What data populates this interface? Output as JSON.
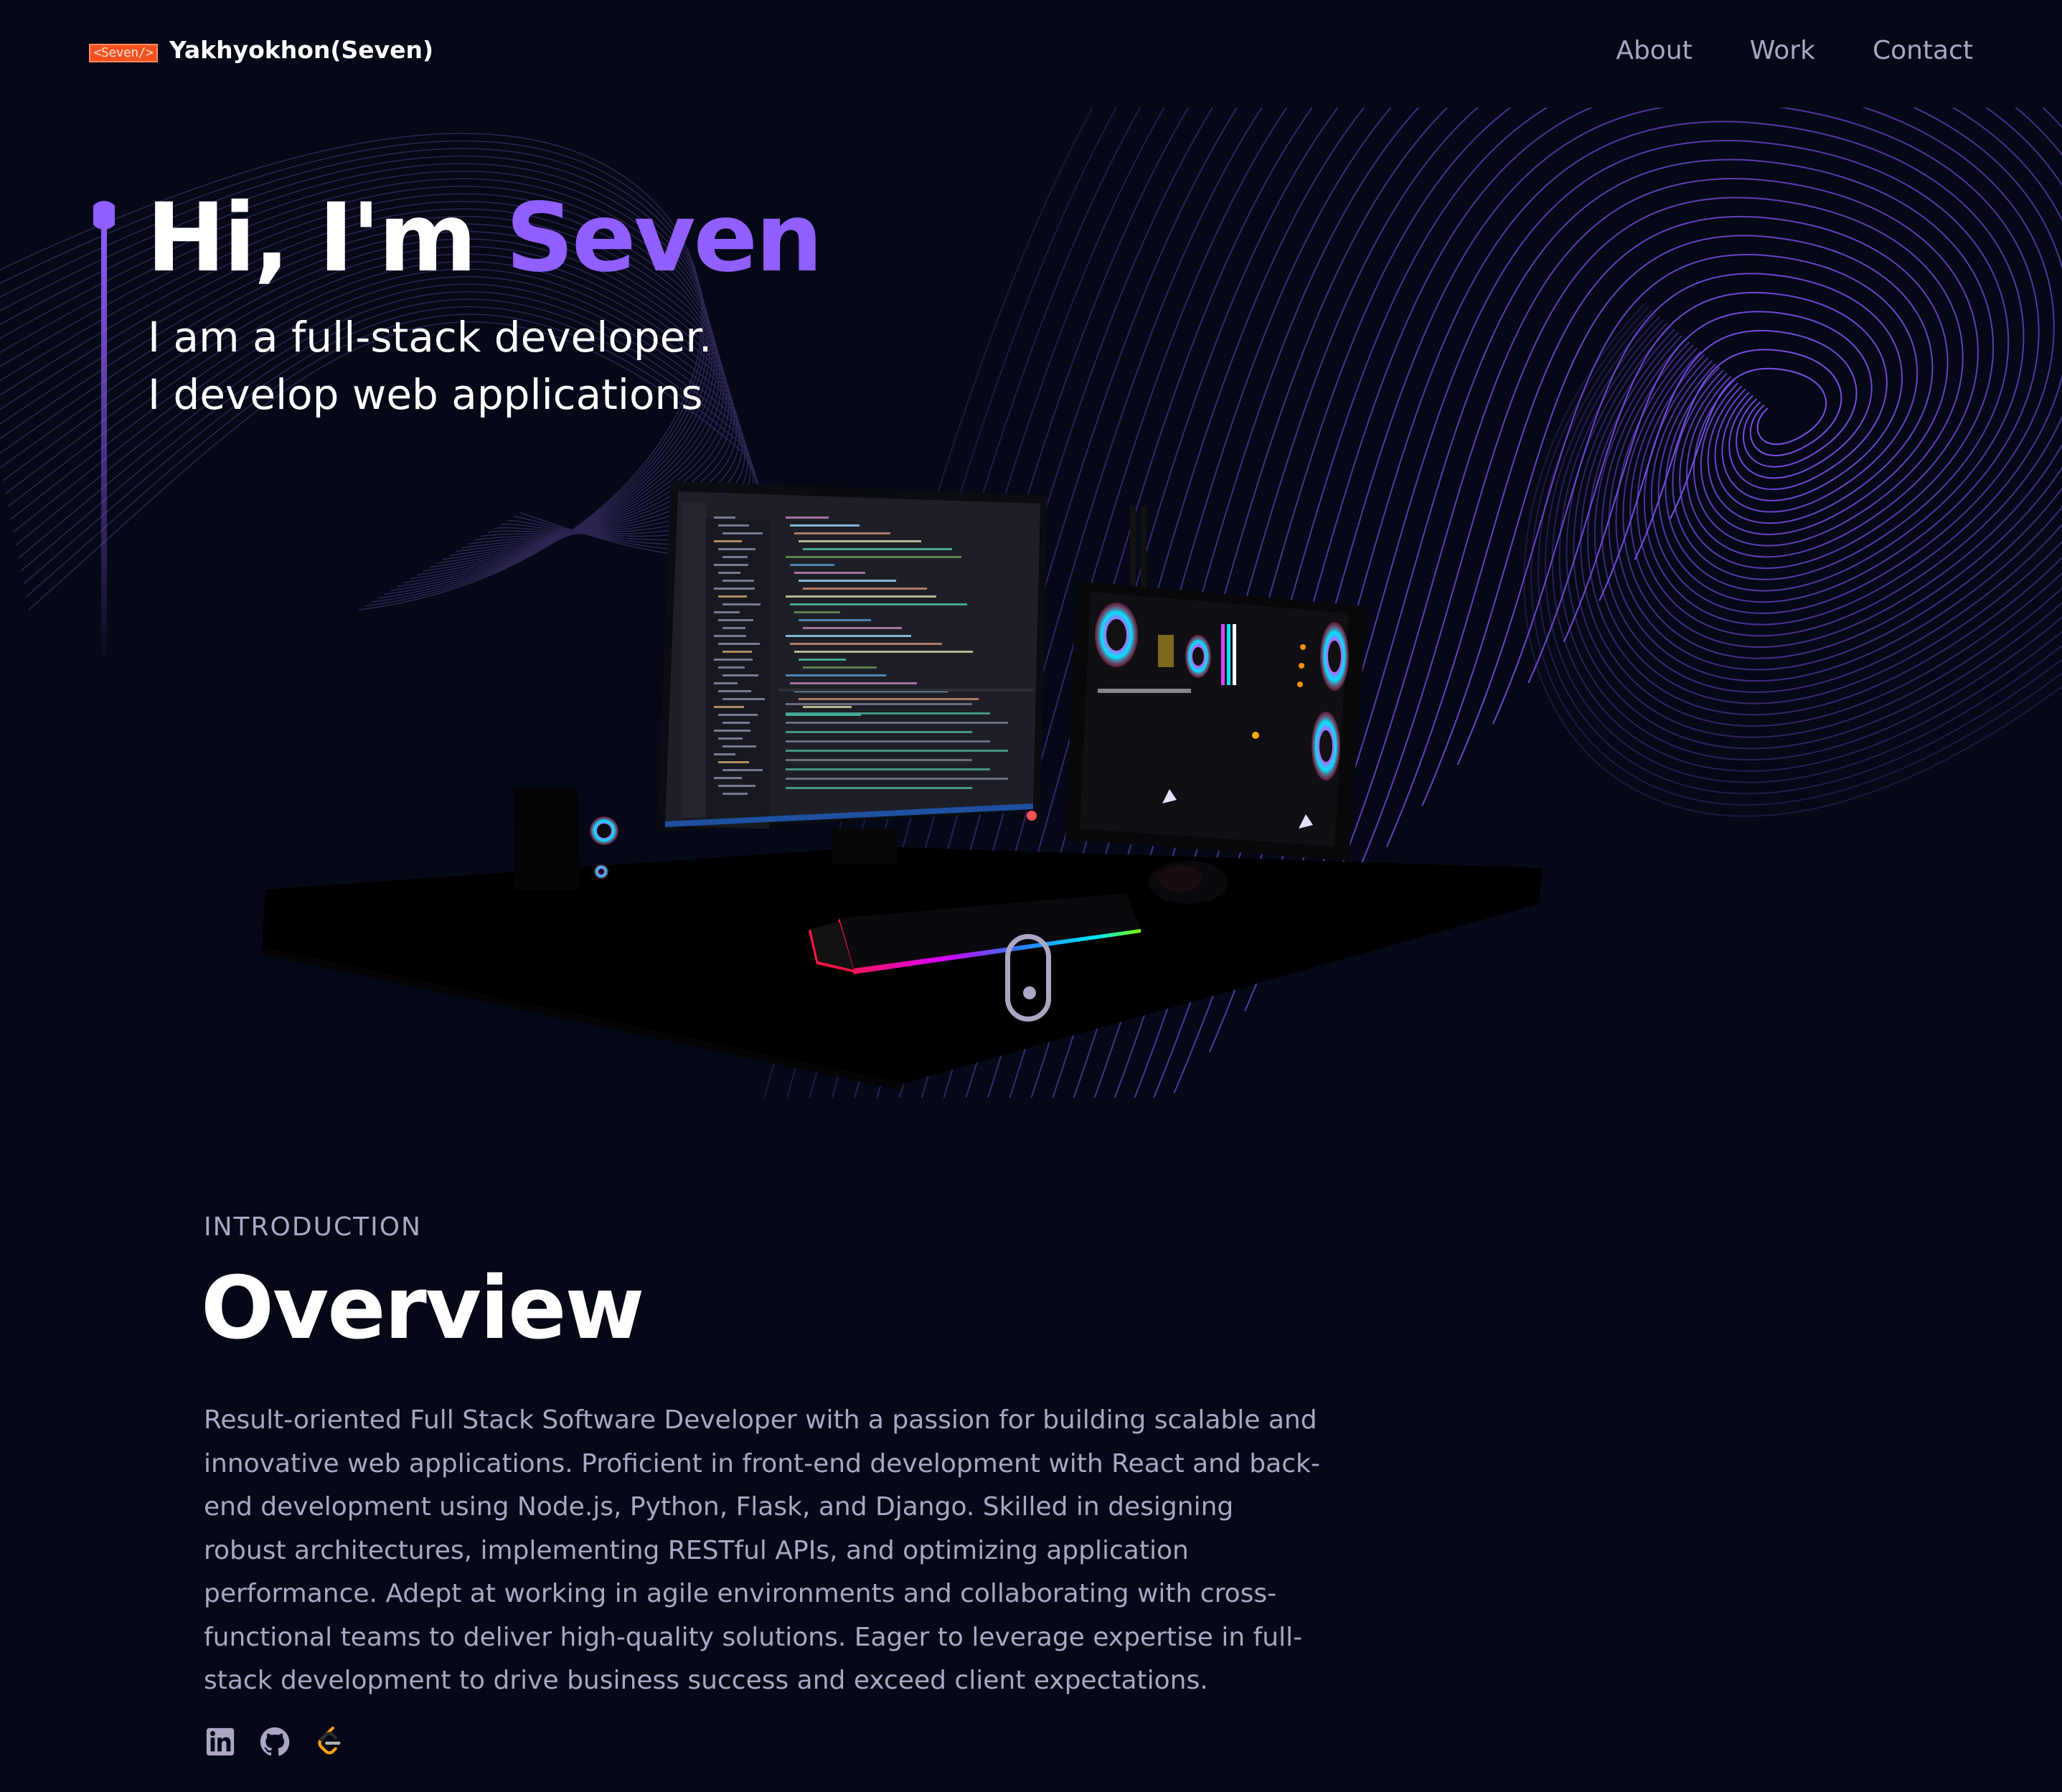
{
  "header": {
    "logo_badge": "<Seven/>",
    "brand_name": "Yakhyokhon(Seven)",
    "nav": [
      {
        "label": "About"
      },
      {
        "label": "Work"
      },
      {
        "label": "Contact"
      }
    ]
  },
  "hero": {
    "title_prefix": "Hi, I'm ",
    "title_name": "Seven",
    "subtitle_line1": "I am a full-stack developer.",
    "subtitle_line2": "I develop web applications"
  },
  "about": {
    "label": "INTRODUCTION",
    "title": "Overview",
    "text": "Result-oriented Full Stack Software Developer with a passion for building scalable and innovative web applications. Proficient in front-end development with React and back-end development using Node.js, Python, Flask, and Django. Skilled in designing robust architectures, implementing RESTful APIs, and optimizing application performance. Adept at working in agile environments and collaborating with cross-functional teams to deliver high-quality solutions. Eager to leverage expertise in full-stack development to drive business success and exceed client expectations."
  },
  "socials": [
    {
      "icon": "linkedin-icon"
    },
    {
      "icon": "github-icon"
    },
    {
      "icon": "leetcode-icon"
    }
  ],
  "colors": {
    "background": "#050816",
    "accent": "#915eff",
    "secondary_text": "#aaa6c3",
    "logo_badge": "#f4511e"
  }
}
